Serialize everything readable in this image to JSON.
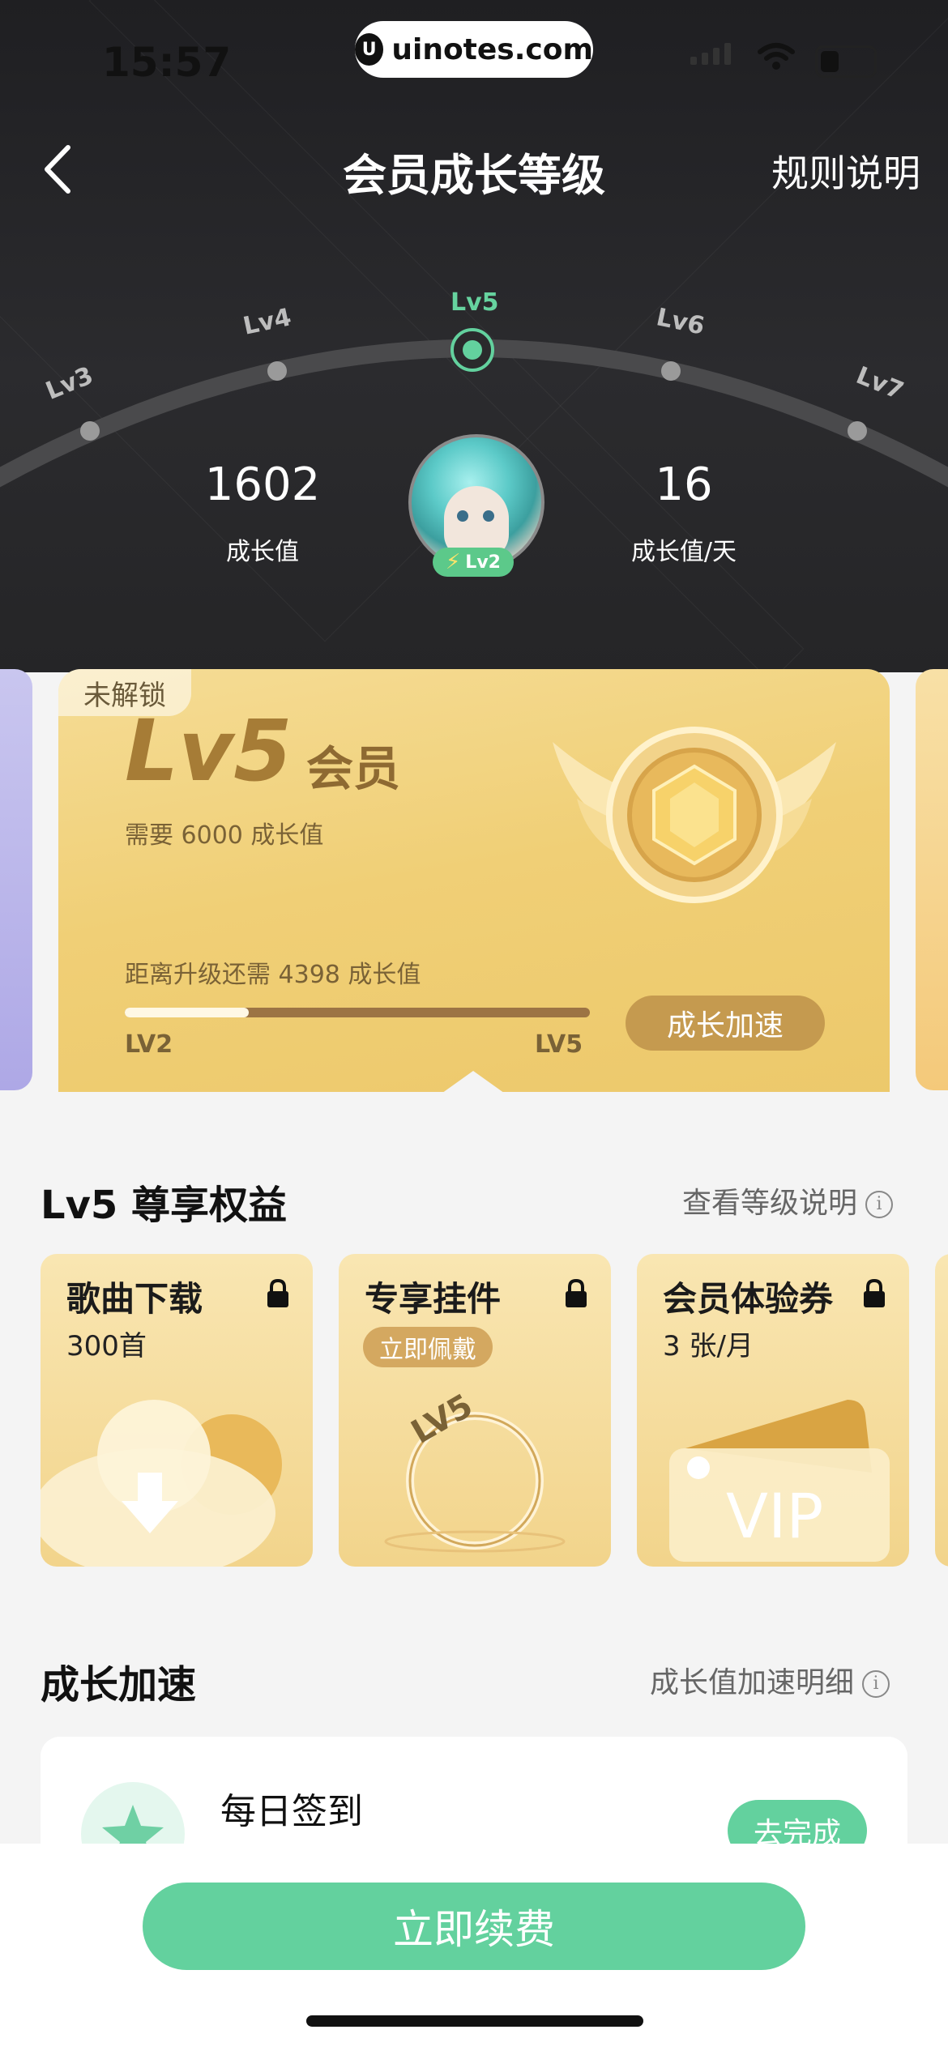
{
  "status_bar": {
    "time": "15:57",
    "watermark": "uinotes.com"
  },
  "header": {
    "title": "会员成长等级",
    "rules_link": "规则说明"
  },
  "level_track": {
    "levels": [
      "Lv3",
      "Lv4",
      "Lv5",
      "Lv6",
      "Lv7"
    ],
    "current": "Lv5"
  },
  "stats": {
    "growth_value": "1602",
    "growth_value_label": "成长值",
    "daily_growth": "16",
    "daily_growth_label": "成长值/天",
    "avatar_badge": "Lv2"
  },
  "level_card": {
    "lock_tag": "未解锁",
    "level": "Lv5",
    "member_word": "会员",
    "required": "需要 6000 成长值",
    "remaining": "距离升级还需 4398 成长值",
    "progress_fraction": 0.267,
    "from_label": "LV2",
    "to_label": "LV5",
    "speed_button": "成长加速"
  },
  "benefits": {
    "title": "Lv5 尊享权益",
    "link": "查看等级说明",
    "items": [
      {
        "name": "歌曲下载",
        "detail": "300首"
      },
      {
        "name": "专享挂件",
        "detail": "立即佩戴",
        "art_text": "LV5"
      },
      {
        "name": "会员体验券",
        "detail": "3 张/月",
        "art_text": "VIP"
      }
    ]
  },
  "growth": {
    "title": "成长加速",
    "link": "成长值加速明细",
    "task": {
      "name": "每日签到",
      "button": "去完成"
    }
  },
  "footer": {
    "renew_button": "立即续费"
  },
  "colors": {
    "accent_green": "#63d19e",
    "gold": "#c59a4f",
    "dark_bg": "#252527"
  }
}
